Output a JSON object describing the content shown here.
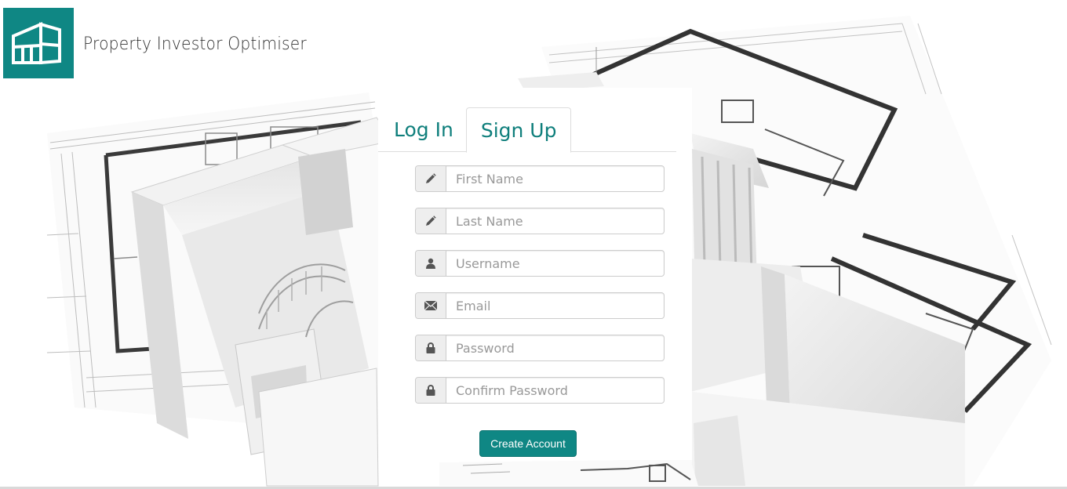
{
  "brand": {
    "name": "Property Investor Optimiser",
    "logo_icon": "building-logo-icon",
    "logo_color": "#0f8784"
  },
  "auth": {
    "tabs": [
      {
        "label": "Log In",
        "active": false
      },
      {
        "label": "Sign Up",
        "active": true
      }
    ],
    "fields": [
      {
        "icon": "pencil-icon",
        "placeholder": "First Name",
        "type": "text",
        "value": ""
      },
      {
        "icon": "pencil-icon",
        "placeholder": "Last Name",
        "type": "text",
        "value": ""
      },
      {
        "icon": "user-icon",
        "placeholder": "Username",
        "type": "text",
        "value": ""
      },
      {
        "icon": "envelope-icon",
        "placeholder": "Email",
        "type": "email",
        "value": ""
      },
      {
        "icon": "lock-icon",
        "placeholder": "Password",
        "type": "password",
        "value": ""
      },
      {
        "icon": "lock-icon",
        "placeholder": "Confirm Password",
        "type": "password",
        "value": ""
      }
    ],
    "submit_label": "Create Account",
    "accent_color": "#0f8784",
    "tab_text_color": "#0f7f7c"
  }
}
